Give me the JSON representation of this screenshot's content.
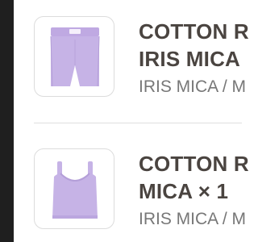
{
  "colors": {
    "rail": "#1f1f1f",
    "product_color": "#c6b3e6",
    "title_text": "#4a4440",
    "variant_text": "#777777"
  },
  "items": [
    {
      "title_line1": "COTTON R",
      "title_line2": "IRIS MICA",
      "variant": "IRIS MICA / M",
      "thumbnail_icon": "shorts-icon"
    },
    {
      "title_line1": "COTTON R",
      "title_line2": "MICA × 1",
      "variant": "IRIS MICA / M",
      "thumbnail_icon": "tank-top-icon"
    }
  ]
}
